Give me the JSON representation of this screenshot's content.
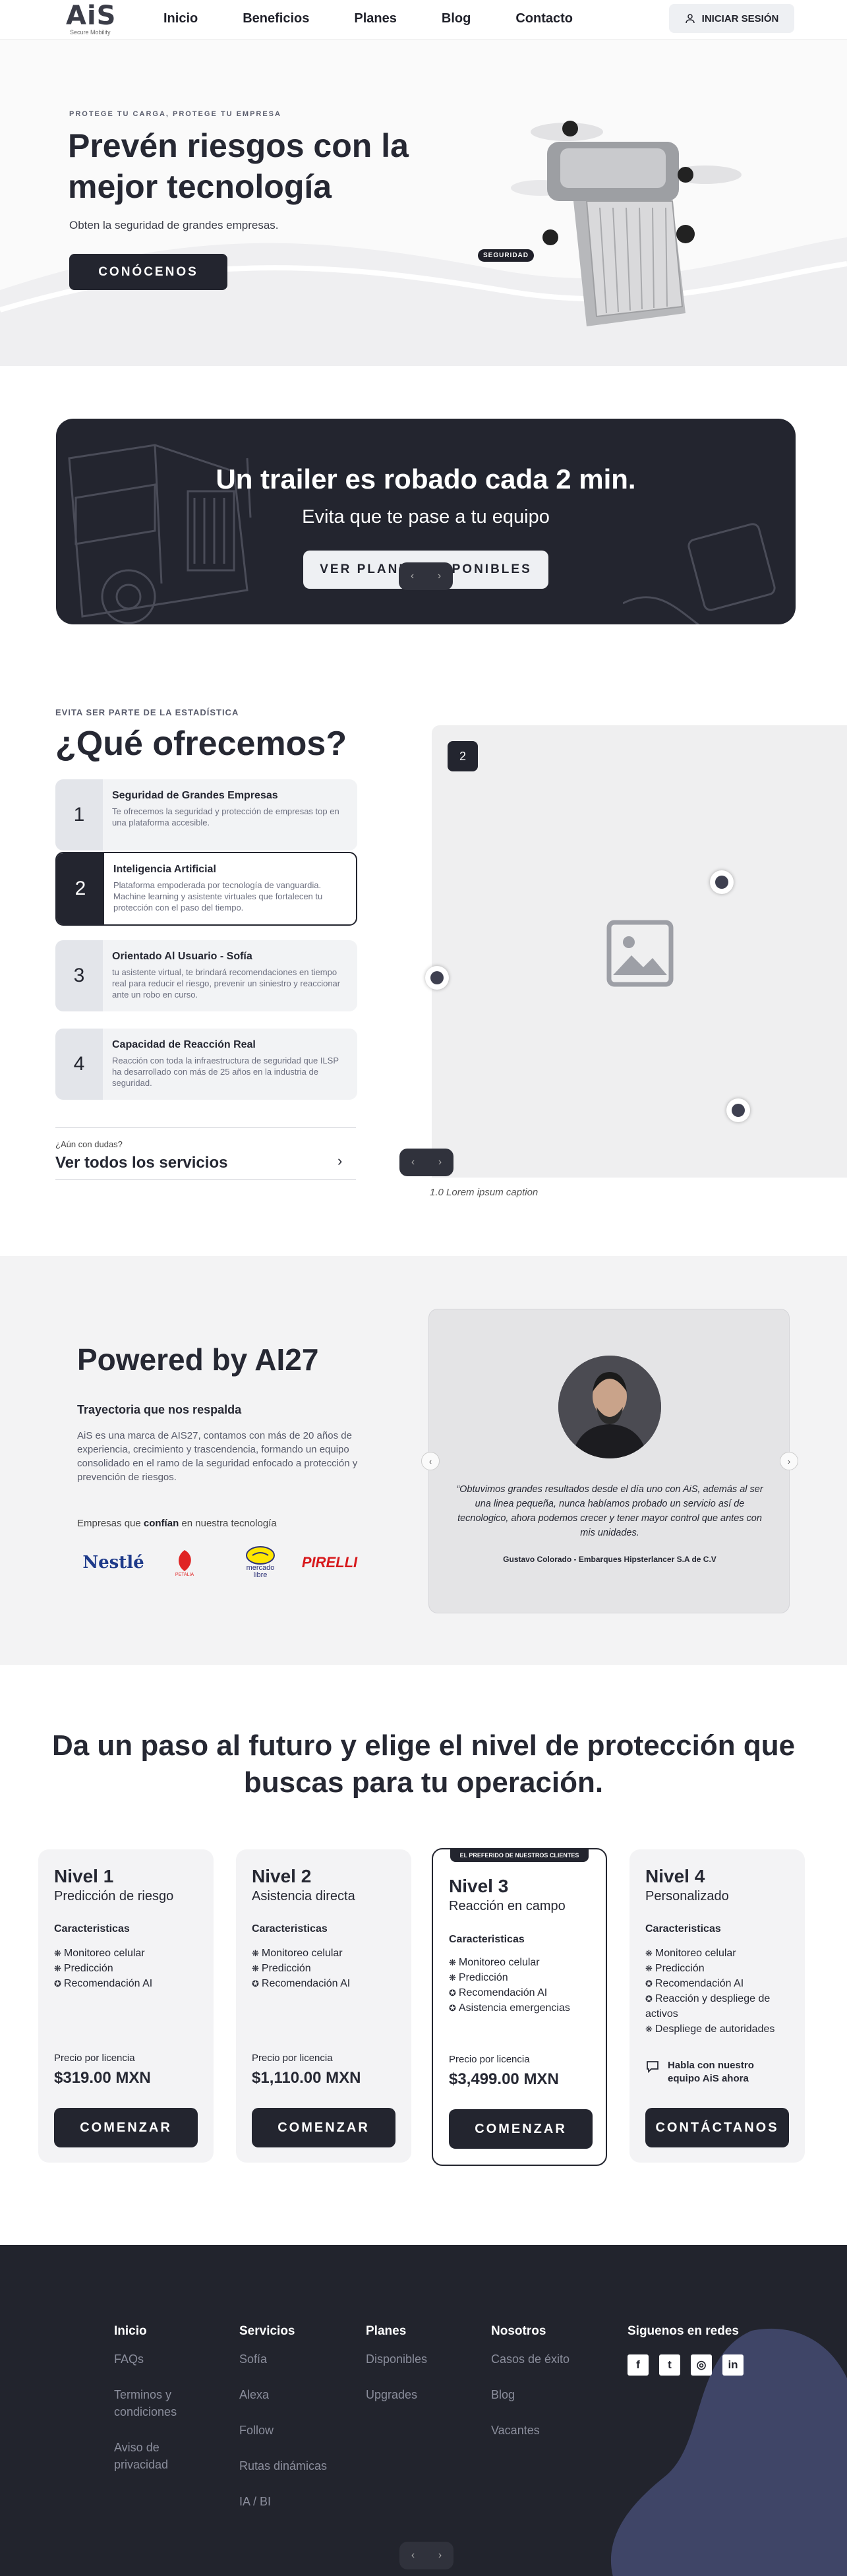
{
  "nav": {
    "logo": "AiS",
    "logo_sub": "Secure Mobility",
    "links": [
      "Inicio",
      "Beneficios",
      "Planes",
      "Blog",
      "Contacto"
    ],
    "login": "INICIAR SESIÓN",
    "login_icon": "user-icon"
  },
  "hero": {
    "kicker": "PROTEGE TU CARGA, PROTEGE TU EMPRESA",
    "title": "Prevén riesgos con la mejor tecnología",
    "subtitle": "Obten la seguridad de grandes empresas.",
    "cta": "CONÓCENOS",
    "badge": "SEGURIDAD"
  },
  "banner": {
    "title": "Un trailer es robado cada 2 min.",
    "subtitle": "Evita que te pase a tu equipo",
    "cta": "VER PLANES DISPONIBLES"
  },
  "offer": {
    "kicker": "EVITA SER PARTE DE LA ESTADÍSTICA",
    "title": "¿Qué ofrecemos?",
    "items": [
      {
        "num": "1",
        "title": "Seguridad de Grandes Empresas",
        "desc": "Te ofrecemos la seguridad y protección de empresas top en una plataforma accesible."
      },
      {
        "num": "2",
        "title": "Inteligencia Artificial",
        "desc": "Plataforma empoderada por tecnología de vanguardia. Machine learning y asistente virtuales que fortalecen tu protección con el paso del tiempo."
      },
      {
        "num": "3",
        "title": "Orientado Al Usuario - Sofía",
        "desc": "tu asistente virtual, te brindará recomendaciones en tiempo real para reducir el riesgo, prevenir un siniestro y reaccionar ante un robo en curso."
      },
      {
        "num": "4",
        "title": "Capacidad de Reacción Real",
        "desc": "Reacción con toda la infraestructura de seguridad que ILSP ha desarrollado con más de 25 años en la industria de seguridad."
      }
    ],
    "question": "¿Aún con dudas?",
    "all_services": "Ver todos los servicios",
    "media_badge": "2",
    "caption": "1.0 Lorem ipsum caption"
  },
  "powered": {
    "title": "Powered by AI27",
    "subtitle": "Trayectoria que nos respalda",
    "text": "AiS es una marca de AIS27, contamos con más de 20 años de experiencia, crecimiento y trascendencia, formando un equipo consolidado en el ramo de la seguridad enfocado a protección y prevención de riesgos.",
    "clients_pre": "Empresas que",
    "clients_bold": "confían",
    "clients_post": "en nuestra tecnología",
    "brands": [
      "Nestlé",
      "PETALIA",
      "mercado libre",
      "PIRELLI"
    ],
    "quote": "“Obtuvimos grandes resultados desde el día uno con AiS, además al ser una linea pequeña, nunca habíamos probado un servicio así de tecnologico, ahora podemos crecer y tener mayor control que antes con mis unidades.",
    "author": "Gustavo Colorado - Embarques Hipsterlancer S.A de C.V"
  },
  "plans": {
    "title": "Da un paso al futuro y elige el nivel de protección que buscas para tu operación.",
    "chars_label": "Caracteristicas",
    "price_label": "Precio por licencia",
    "items": [
      {
        "name": "Nivel 1",
        "tag": "Predicción de riesgo",
        "feats": [
          "Monitoreo celular",
          "Predicción",
          "Recomendación AI"
        ],
        "price": "$319.00 MXN",
        "cta": "COMENZAR"
      },
      {
        "name": "Nivel 2",
        "tag": "Asistencia directa",
        "feats": [
          "Monitoreo celular",
          "Predicción",
          "Recomendación AI"
        ],
        "price": "$1,110.00 MXN",
        "cta": "COMENZAR"
      },
      {
        "name": "Nivel 3",
        "tag": "Reacción en campo",
        "feats": [
          "Monitoreo celular",
          "Predicción",
          "Recomendación AI",
          "Asistencia emergencias"
        ],
        "price": "$3,499.00 MXN",
        "cta": "COMENZAR",
        "flag": "EL PREFERIDO DE NUESTROS CLIENTES"
      },
      {
        "name": "Nivel 4",
        "tag": "Personalizado",
        "feats": [
          "Monitoreo celular",
          "Predicción",
          "Recomendación AI",
          "Reacción y despliege de activos",
          "Despliege de autoridades"
        ],
        "chat": "Habla con nuestro equipo AiS ahora",
        "cta": "CONTÁCTANOS"
      }
    ]
  },
  "footer": {
    "cols": [
      {
        "head": "Inicio",
        "links": [
          "FAQs",
          "Terminos y condiciones",
          "Aviso de privacidad"
        ]
      },
      {
        "head": "Servicios",
        "links": [
          "Sofía",
          "Alexa",
          "Follow",
          "Rutas dinámicas",
          "IA / BI"
        ]
      },
      {
        "head": "Planes",
        "links": [
          "Disponibles",
          "Upgrades"
        ]
      },
      {
        "head": "Nosotros",
        "links": [
          "Casos de éxito",
          "Blog",
          "Vacantes"
        ]
      }
    ],
    "social_head": "Siguenos en redes",
    "social": [
      "f",
      "t",
      "◎",
      "in"
    ]
  }
}
